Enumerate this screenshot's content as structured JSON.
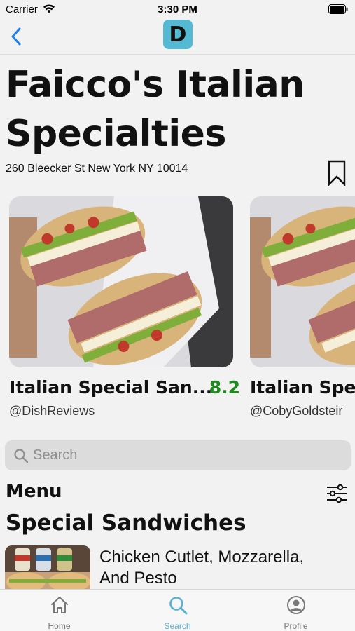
{
  "status_bar": {
    "carrier": "Carrier",
    "time": "3:30 PM"
  },
  "nav": {
    "back_icon": "chevron-left-icon",
    "logo_letter": "D",
    "logo_color": "#56b9d3",
    "accent_color": "#1a7ef0"
  },
  "restaurant": {
    "name": "Faicco's Italian Specialties",
    "address": "260 Bleecker St New York NY 10014"
  },
  "reviews": [
    {
      "dish": "Italian Special San...",
      "score": "8.2",
      "author": "@DishReviews"
    },
    {
      "dish": "Italian Spe",
      "score": "",
      "author": "@CobyGoldsteir"
    }
  ],
  "score_color": "#1e8a1e",
  "search": {
    "placeholder": "Search"
  },
  "menu": {
    "heading": "Menu",
    "sections": [
      {
        "title": "Special Sandwiches",
        "items": [
          {
            "name": "Chicken Cutlet, Mozzarella, And Pesto"
          }
        ]
      }
    ]
  },
  "tab_bar": {
    "tabs": [
      {
        "label": "Home",
        "icon": "home-icon",
        "active": false
      },
      {
        "label": "Search",
        "icon": "search-icon",
        "active": true
      },
      {
        "label": "Profile",
        "icon": "profile-icon",
        "active": false
      }
    ],
    "active_color": "#5aaed2",
    "inactive_color": "#777777"
  }
}
